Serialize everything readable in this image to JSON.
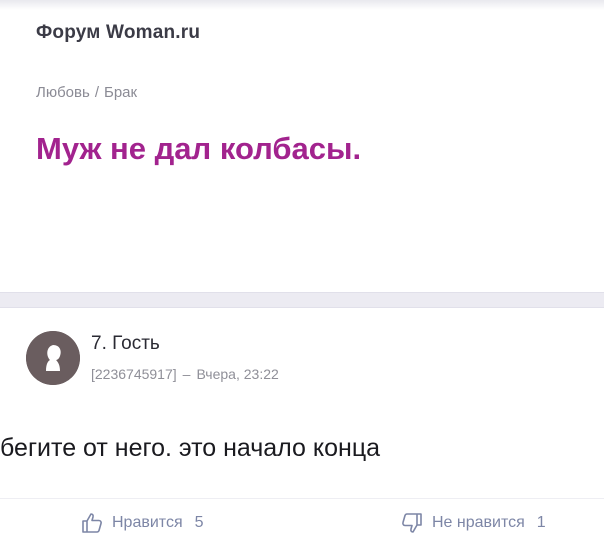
{
  "header": {
    "forum_name": "Форум Woman.ru"
  },
  "breadcrumb": {
    "items": [
      "Любовь",
      "Брак"
    ],
    "separator": "/"
  },
  "topic": {
    "title": "Муж не дал колбасы."
  },
  "post": {
    "author": "7. Гость",
    "id": "[2236745917]",
    "meta_separator": "–",
    "time": "Вчера, 23:22",
    "body": "бегите от него. это начало конца"
  },
  "actions": {
    "like_label": "Нравится",
    "like_count": "5",
    "dislike_label": "Не нравится",
    "dislike_count": "1"
  },
  "colors": {
    "title_accent": "#a2238e",
    "action_text": "#7d86a6",
    "avatar_bg": "#6a5d5f"
  },
  "icons": {
    "avatar": "user-silhouette-icon",
    "like": "thumbs-up-icon",
    "dislike": "thumbs-down-icon"
  }
}
